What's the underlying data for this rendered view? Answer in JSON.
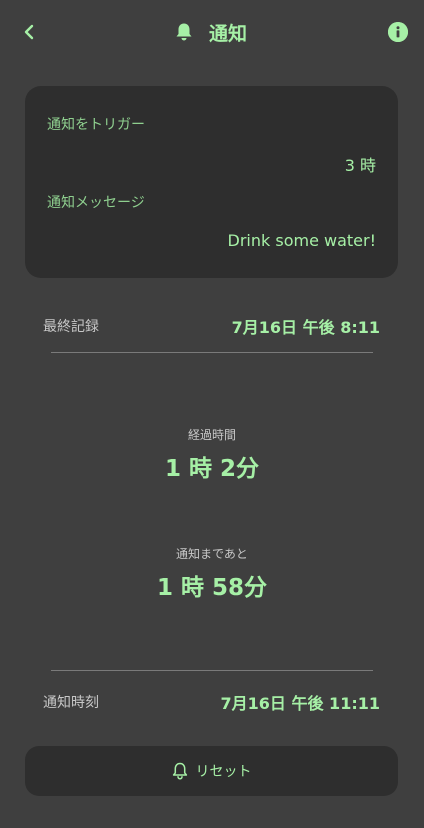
{
  "header": {
    "title": "通知",
    "back_icon": "chevron-left-icon",
    "title_icon": "bell-icon",
    "info_icon": "info-icon"
  },
  "trigger_card": {
    "trigger_label": "通知をトリガー",
    "trigger_value": "3 時",
    "message_label": "通知メッセージ",
    "message_value": "Drink some water!"
  },
  "last_record": {
    "label": "最終記録",
    "value": "7月16日  午後 8:11"
  },
  "elapsed": {
    "label": "経過時間",
    "value": "1 時 2分"
  },
  "remaining": {
    "label": "通知まであと",
    "value": "1 時 58分"
  },
  "notify_time": {
    "label": "通知時刻",
    "value": "7月16日  午後 11:11"
  },
  "reset_button": {
    "label": "リセット",
    "icon": "bell-outline-icon"
  },
  "colors": {
    "background": "#3f3f3f",
    "card": "#2e2e2e",
    "accent": "#a6f0a6"
  }
}
